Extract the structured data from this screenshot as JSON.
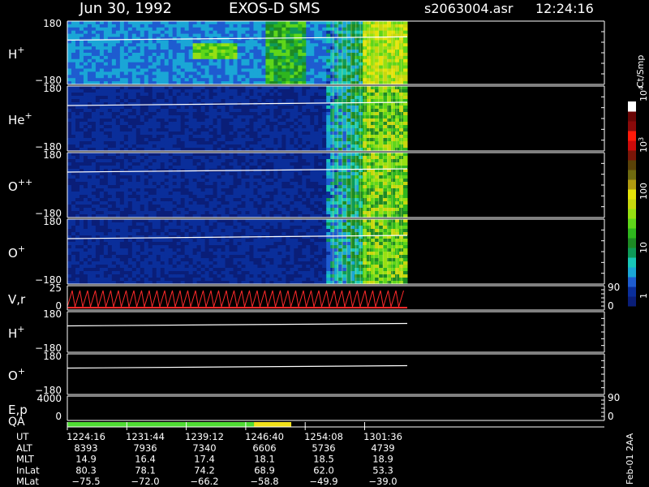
{
  "header": {
    "date": "Jun 30, 1992",
    "instrument": "EXOS-D SMS",
    "file": "s2063004.asr",
    "time": "12:24:16"
  },
  "footer_tag": "Feb-01 2AA",
  "colorbar": {
    "unit": "Ct/Smp",
    "tick_labels": [
      "1",
      "10",
      "100",
      "10",
      "10"
    ],
    "tick_exponents": [
      "",
      "",
      "",
      "3",
      "4"
    ],
    "tick_values": [
      1,
      10,
      100,
      1000,
      10000
    ],
    "colors": [
      "#0a1e78",
      "#0a2e9a",
      "#1e5cd0",
      "#1aa6d6",
      "#18c7b8",
      "#0e9a58",
      "#1d8a24",
      "#2fb61e",
      "#5fd61a",
      "#96e012",
      "#c8d80e",
      "#e4e40a",
      "#b09a10",
      "#6e6a10",
      "#5a4208",
      "#7a1608",
      "#cc0a0a",
      "#ff1a0a",
      "#8a0a0a",
      "#6a0505",
      "#ffffff"
    ]
  },
  "panels": [
    {
      "label": "H",
      "sup": "+",
      "ymax": "180",
      "ymin": "−180",
      "type": "spectrogram"
    },
    {
      "label": "He",
      "sup": "+",
      "ymax": "180",
      "ymin": "−180",
      "type": "spectrogram"
    },
    {
      "label": "O",
      "sup": "++",
      "ymax": "180",
      "ymin": "−180",
      "type": "spectrogram"
    },
    {
      "label": "O",
      "sup": "+",
      "ymax": "180",
      "ymin": "−180",
      "type": "spectrogram"
    },
    {
      "label": "V,r",
      "sup": "",
      "ymax": "25",
      "ymin": "0",
      "right_max": "90",
      "right_min": "0",
      "type": "line"
    },
    {
      "label": "H",
      "sup": "+",
      "ymax": "180",
      "ymin": "−180",
      "type": "line"
    },
    {
      "label": "O",
      "sup": "+",
      "ymax": "180",
      "ymin": "−180",
      "type": "line"
    },
    {
      "label": "E,p",
      "sup": "",
      "ymax": "4000",
      "ymin": "0",
      "right_max": "90",
      "right_min": "0",
      "type": "line"
    }
  ],
  "qa_label": "QA",
  "time_axis": {
    "rows": [
      {
        "name": "UT",
        "values": [
          "1224:16",
          "1231:44",
          "1239:12",
          "1246:40",
          "1254:08",
          "1301:36"
        ]
      },
      {
        "name": "ALT",
        "values": [
          "8393",
          "7936",
          "7340",
          "6606",
          "5736",
          "4739"
        ]
      },
      {
        "name": "MLT",
        "values": [
          "14.9",
          "16.4",
          "17.4",
          "18.1",
          "18.5",
          "18.9"
        ]
      },
      {
        "name": "InLat",
        "values": [
          "80.3",
          "78.1",
          "74.2",
          "68.9",
          "62.0",
          "53.3"
        ]
      },
      {
        "name": "MLat",
        "values": [
          "−75.5",
          "−72.0",
          "−66.2",
          "−58.8",
          "−49.9",
          "−39.0"
        ]
      }
    ]
  },
  "chart_data": {
    "type": "heatmap",
    "title": "Jun 30, 1992   EXOS-D SMS",
    "x_ticks": [
      "1224:16",
      "1231:44",
      "1239:12",
      "1246:40",
      "1254:08",
      "1301:36"
    ],
    "x_data_coverage": [
      0,
      0.6
    ],
    "y_range_pitch": [
      -180,
      180
    ],
    "qa_segments": [
      {
        "from": 0.0,
        "to": 0.5,
        "color": "#4fdc34"
      },
      {
        "from": 0.5,
        "to": 0.6,
        "color": "#f3e21a"
      }
    ]
  }
}
